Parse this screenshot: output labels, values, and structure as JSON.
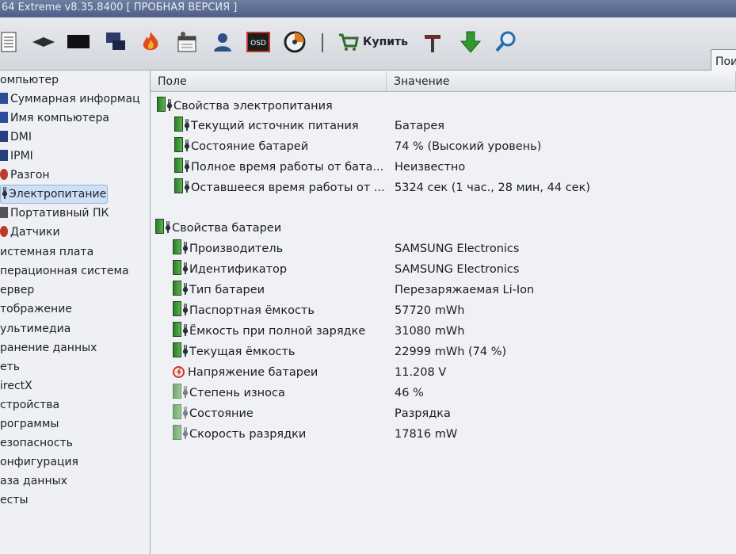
{
  "window": {
    "title": "64 Extreme v8.35.8400  [ ПРОБНАЯ ВЕРСИЯ ]"
  },
  "toolbar": {
    "buy_label": "Купить",
    "search_placeholder": "Пои",
    "icons": [
      "report-icon",
      "motherboard-icon",
      "monitor-icon",
      "network-icon",
      "flame-icon",
      "calendar-icon",
      "user-icon",
      "osd-icon",
      "disc-icon",
      "buy-icon",
      "tools-icon",
      "download-icon",
      "search-icon"
    ]
  },
  "tree": {
    "items": [
      {
        "label": "омпьютер"
      },
      {
        "label": "Суммарная информац"
      },
      {
        "label": "Имя компьютера"
      },
      {
        "label": "DMI"
      },
      {
        "label": "IPMI"
      },
      {
        "label": "Разгон"
      },
      {
        "label": "Электропитание"
      },
      {
        "label": "Портативный ПК"
      },
      {
        "label": "Датчики"
      },
      {
        "label": "истемная плата"
      },
      {
        "label": "перационная система"
      },
      {
        "label": "ервер"
      },
      {
        "label": "тображение"
      },
      {
        "label": "ультимедиа"
      },
      {
        "label": "ранение данных"
      },
      {
        "label": "еть"
      },
      {
        "label": "irectX"
      },
      {
        "label": "стройства"
      },
      {
        "label": "рограммы"
      },
      {
        "label": "езопасность"
      },
      {
        "label": "онфигурация"
      },
      {
        "label": "аза данных"
      },
      {
        "label": "есты"
      }
    ]
  },
  "table": {
    "col_field": "Поле",
    "col_value": "Значение",
    "sections": [
      {
        "title": "Свойства электропитания",
        "rows": [
          {
            "field": "Текущий источник питания",
            "value": "Батарея"
          },
          {
            "field": "Состояние батарей",
            "value": "74 % (Высокий уровень)"
          },
          {
            "field": "Полное время работы от бата...",
            "value": "Неизвестно"
          },
          {
            "field": "Оставшееся время работы от ...",
            "value": "5324 сек (1 час., 28 мин, 44 сек)"
          }
        ]
      },
      {
        "title": "Свойства батареи",
        "rows": [
          {
            "field": "Производитель",
            "value": "SAMSUNG Electronics"
          },
          {
            "field": "Идентификатор",
            "value": "SAMSUNG Electronics"
          },
          {
            "field": "Тип батареи",
            "value": "Перезаряжаемая Li-Ion"
          },
          {
            "field": "Паспортная ёмкость",
            "value": "57720 mWh"
          },
          {
            "field": "Ёмкость при полной зарядке",
            "value": "31080 mWh"
          },
          {
            "field": "Текущая ёмкость",
            "value": "22999 mWh  (74 %)"
          },
          {
            "field": "Напряжение батареи",
            "value": "11.208 V"
          },
          {
            "field": "Степень износа",
            "value": "46 %"
          },
          {
            "field": "Состояние",
            "value": "Разрядка"
          },
          {
            "field": "Скорость разрядки",
            "value": "17816 mW"
          }
        ]
      }
    ]
  }
}
